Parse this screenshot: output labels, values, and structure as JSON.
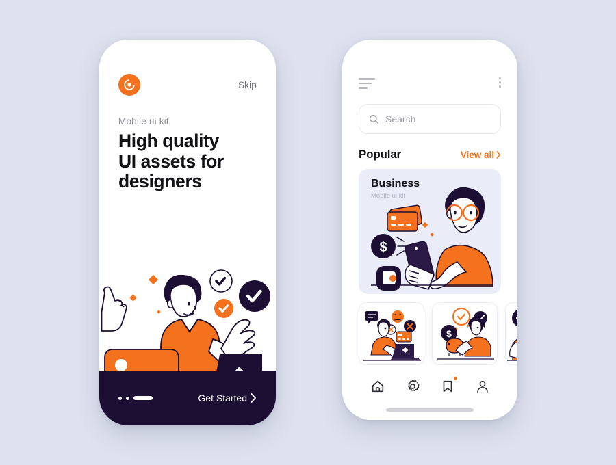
{
  "theme": {
    "background": "#dee2ee",
    "accent_orange": "#f4711e",
    "dark_navy": "#1d0f33",
    "card_lavender": "#eaecf7",
    "text_primary": "#111116",
    "text_muted": "#8c8c95"
  },
  "onboarding_screen": {
    "logo_icon": "app-logo-spiral-icon",
    "skip_label": "Skip",
    "kicker": "Mobile ui kit",
    "headline_lines": [
      "High quality",
      "UI assets for",
      "designers"
    ],
    "illustration": {
      "name": "person-pointing-with-card-and-laptop",
      "elements": [
        "pointing-hand",
        "check-badge-outline",
        "check-badge-orange",
        "check-badge-black",
        "orange-credit-card",
        "laptop",
        "orange-diamonds"
      ]
    },
    "pagination": {
      "total": 3,
      "active_index": 2
    },
    "cta_label": "Get Started",
    "cta_icon": "chevron-right-icon"
  },
  "browse_screen": {
    "menu_icon": "hamburger-menu-icon",
    "overflow_icon": "kebab-menu-icon",
    "search": {
      "placeholder": "Search",
      "value": "",
      "icon": "search-icon"
    },
    "section": {
      "title": "Popular",
      "view_all_label": "View all",
      "view_all_icon": "chevron-right-icon"
    },
    "featured_card": {
      "title": "Business",
      "subtitle": "Mobile ui kit",
      "illustration": "person-with-glasses-holding-phone-payments"
    },
    "thumbnails": [
      {
        "name": "thumb-chat-laptop",
        "illustration": "person-at-laptop-with-speech-bubbles"
      },
      {
        "name": "thumb-savings",
        "illustration": "woman-with-piggy-bank-and-coin"
      },
      {
        "name": "thumb-messages",
        "illustration": "chat-bubble-partial"
      }
    ],
    "tabbar": [
      {
        "name": "home",
        "icon": "home-icon",
        "active": true,
        "badge": false
      },
      {
        "name": "settings",
        "icon": "gear-icon",
        "active": false,
        "badge": false
      },
      {
        "name": "bookmarks",
        "icon": "bookmark-icon",
        "active": false,
        "badge": true
      },
      {
        "name": "profile",
        "icon": "person-icon",
        "active": false,
        "badge": false
      }
    ],
    "home_indicator": "home-indicator-bar"
  }
}
